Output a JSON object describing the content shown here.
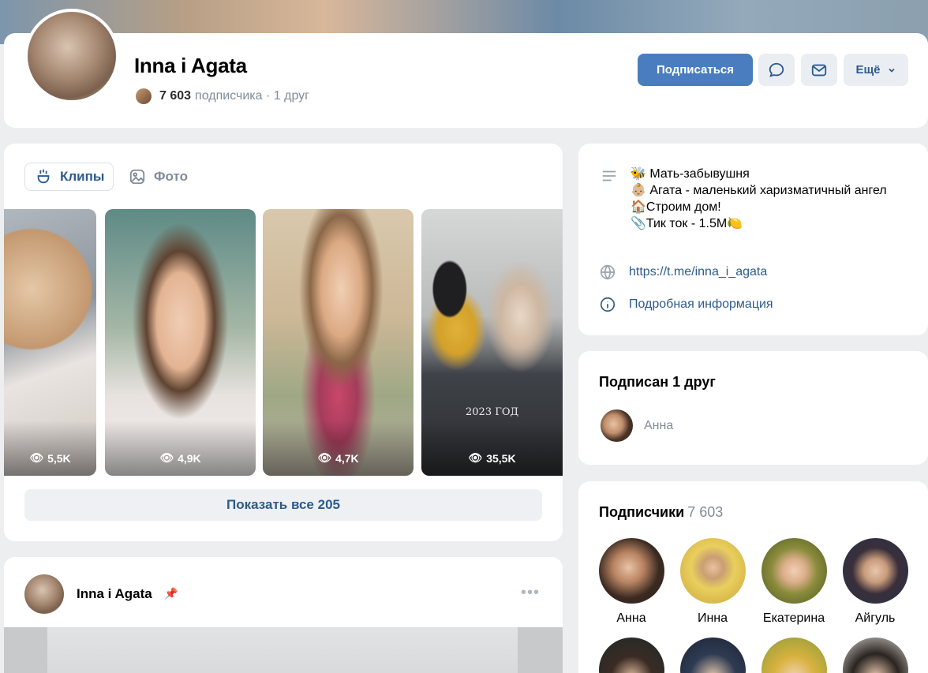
{
  "profile": {
    "name": "Inna i Agata",
    "followers_count": "7 603",
    "followers_suffix": "подписчика · 1 друг"
  },
  "actions": {
    "subscribe": "Подписаться",
    "more": "Ещё"
  },
  "clips": {
    "tab_clips": "Клипы",
    "tab_photo": "Фото",
    "items": [
      {
        "views": "5,5K"
      },
      {
        "views": "4,9K"
      },
      {
        "views": "4,7K"
      },
      {
        "views": "35,5K",
        "caption": "2023 ГОД"
      }
    ],
    "show_all": "Показать все 205"
  },
  "post": {
    "author": "Inna i Agata",
    "pin_icon": "pin-icon"
  },
  "about": {
    "lines": [
      "🐝 Мать-забывушня",
      "👶🏼 Агата - маленький харизматичный ангел",
      "🏠Строим дом!",
      "📎Тик ток - 1.5M🍋"
    ],
    "link": "https://t.me/inna_i_agata",
    "details": "Подробная информация"
  },
  "friends": {
    "title": "Подписан 1 друг",
    "items": [
      {
        "name": "Анна"
      }
    ]
  },
  "subscribers": {
    "title": "Подписчики",
    "count": "7 603",
    "items": [
      {
        "name": "Анна",
        "color": "#3b2a22"
      },
      {
        "name": "Инна",
        "color": "#d9b04a"
      },
      {
        "name": "Екатерина",
        "color": "#6f7a3a"
      },
      {
        "name": "Айгуль",
        "color": "#2a3a55"
      }
    ]
  },
  "colors": {
    "accent": "#4a7dbf",
    "link": "#2d5b8d",
    "secondary_text": "#818c99"
  }
}
